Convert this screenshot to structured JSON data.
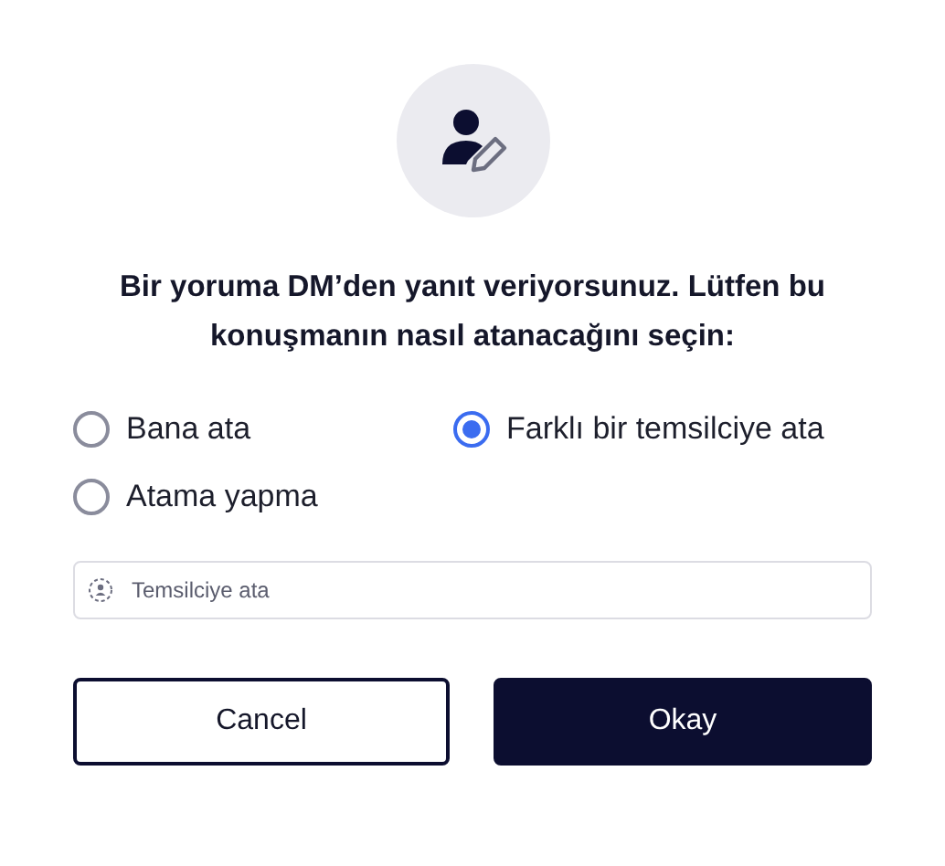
{
  "prompt": "Bir yoruma DM’den yanıt veriyorsunuz. Lütfen bu konuşmanın nasıl atanacağını seçin:",
  "options": [
    {
      "label": "Bana ata",
      "selected": false
    },
    {
      "label": "Farklı bir temsilciye ata",
      "selected": true
    },
    {
      "label": "Atama yapma",
      "selected": false
    }
  ],
  "agent_field": {
    "placeholder": "Temsilciye ata"
  },
  "buttons": [
    {
      "label": "Cancel",
      "kind": "secondary"
    },
    {
      "label": "Okay",
      "kind": "primary"
    }
  ]
}
